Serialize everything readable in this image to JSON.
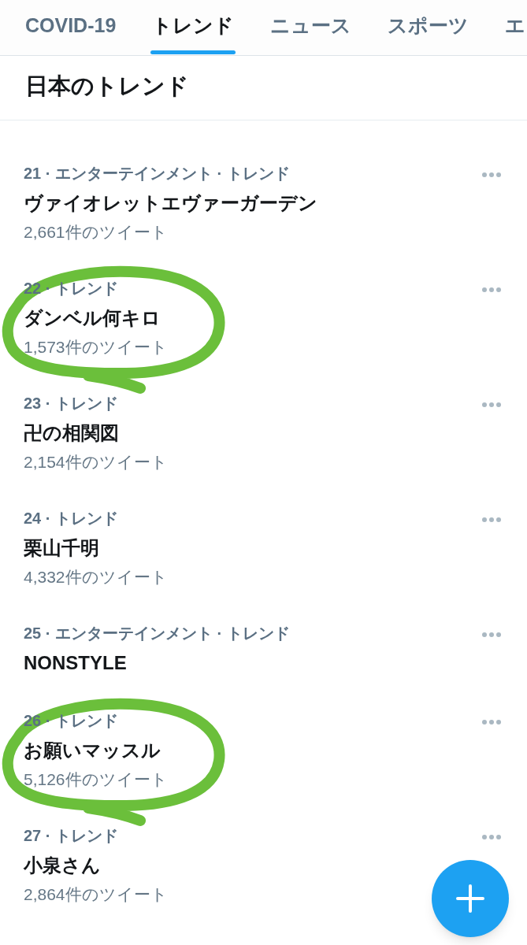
{
  "tabs": [
    {
      "label": "COVID-19",
      "selected": false
    },
    {
      "label": "トレンド",
      "selected": true
    },
    {
      "label": "ニュース",
      "selected": false
    },
    {
      "label": "スポーツ",
      "selected": false
    },
    {
      "label": "エ",
      "selected": false
    }
  ],
  "section_title": "日本のトレンド",
  "trends": [
    {
      "meta": "21 · エンターテインメント · トレンド",
      "title": "ヴァイオレットエヴァーガーデン",
      "tweets": "2,661件のツイート",
      "circled": false
    },
    {
      "meta": "22 · トレンド",
      "title": "ダンベル何キロ",
      "tweets": "1,573件のツイート",
      "circled": true
    },
    {
      "meta": "23 · トレンド",
      "title": "卍の相関図",
      "tweets": "2,154件のツイート",
      "circled": false
    },
    {
      "meta": "24 · トレンド",
      "title": "栗山千明",
      "tweets": "4,332件のツイート",
      "circled": false
    },
    {
      "meta": "25 · エンターテインメント · トレンド",
      "title": "NONSTYLE",
      "circled": false
    },
    {
      "meta": "26 · トレンド",
      "title": "お願いマッスル",
      "tweets": "5,126件のツイート",
      "circled": true
    },
    {
      "meta": "27 · トレンド",
      "title": "小泉さん",
      "tweets": "2,864件のツイート",
      "circled": false
    }
  ]
}
